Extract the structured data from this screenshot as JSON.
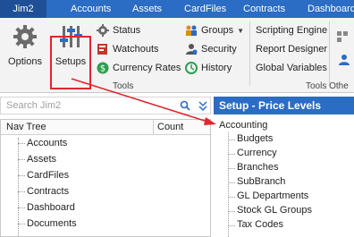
{
  "menubar": {
    "app_name": "Jim2",
    "items": [
      "Accounts",
      "Assets",
      "CardFiles",
      "Contracts",
      "Dashboard"
    ]
  },
  "ribbon": {
    "options_label": "Options",
    "setups_label": "Setups",
    "tools_small": [
      {
        "label": "Status",
        "icon": "gear-small-icon"
      },
      {
        "label": "Watchouts",
        "icon": "watchouts-icon"
      },
      {
        "label": "Currency Rates",
        "icon": "currency-icon"
      }
    ],
    "tools_small_2": [
      {
        "label": "Groups",
        "icon": "groups-icon"
      },
      {
        "label": "Security",
        "icon": "security-icon"
      },
      {
        "label": "History",
        "icon": "history-icon"
      }
    ],
    "other_tools": [
      "Scripting Engine",
      "Report Designer",
      "Global Variables"
    ],
    "group_tools": "Tools",
    "group_other": "Tools Othe",
    "highlight_color": "#e0262b"
  },
  "search": {
    "placeholder": "Search Jim2"
  },
  "navtree": {
    "columns": [
      "Nav Tree",
      "Count"
    ],
    "items": [
      "Accounts",
      "Assets",
      "CardFiles",
      "Contracts",
      "Dashboard",
      "Documents"
    ]
  },
  "right_panel": {
    "title": "Setup - Price Levels",
    "root": "Accounting",
    "children": [
      "Budgets",
      "Currency",
      "Branches",
      "SubBranch",
      "GL Departments",
      "Stock GL Groups",
      "Tax Codes"
    ]
  },
  "colors": {
    "accent": "#2b6cc4",
    "dark_accent": "#1f4f96",
    "arrow": "#e0262b"
  }
}
